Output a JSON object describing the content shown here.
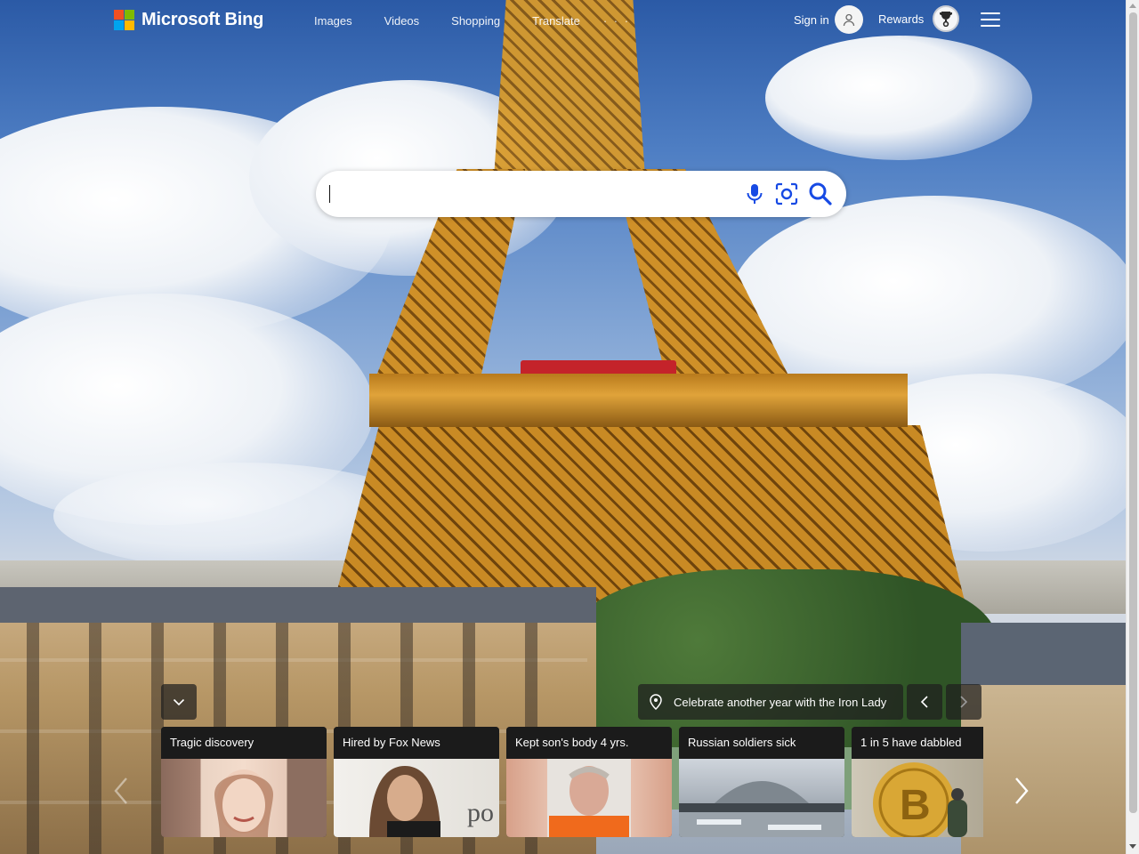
{
  "header": {
    "logo_text": "Microsoft Bing",
    "nav": [
      {
        "label": "Images"
      },
      {
        "label": "Videos"
      },
      {
        "label": "Shopping"
      },
      {
        "label": "Translate"
      }
    ],
    "more_label": "· · ·",
    "signin_label": "Sign in",
    "rewards_label": "Rewards"
  },
  "search": {
    "value": "",
    "placeholder": ""
  },
  "image_of_day": {
    "title": "Celebrate another year with the Iron Lady"
  },
  "news": [
    {
      "title": "Tragic discovery",
      "thumb": "woman-portrait",
      "color": "#b88a78"
    },
    {
      "title": "Hired by Fox News",
      "thumb": "woman-portrait",
      "color": "#d9d5cf"
    },
    {
      "title": "Kept son's body 4 yrs.",
      "thumb": "mugshot",
      "color": "#d86a2c"
    },
    {
      "title": "Russian soldiers sick",
      "thumb": "power-plant",
      "color": "#8d97a2"
    },
    {
      "title": "1 in 5 have dabbled",
      "thumb": "bitcoin",
      "color": "#c9992e"
    }
  ],
  "colors": {
    "ms_red": "#f25022",
    "ms_green": "#7fba00",
    "ms_blue": "#00a4ef",
    "ms_yellow": "#ffb900",
    "search_icon": "#174ae4"
  }
}
